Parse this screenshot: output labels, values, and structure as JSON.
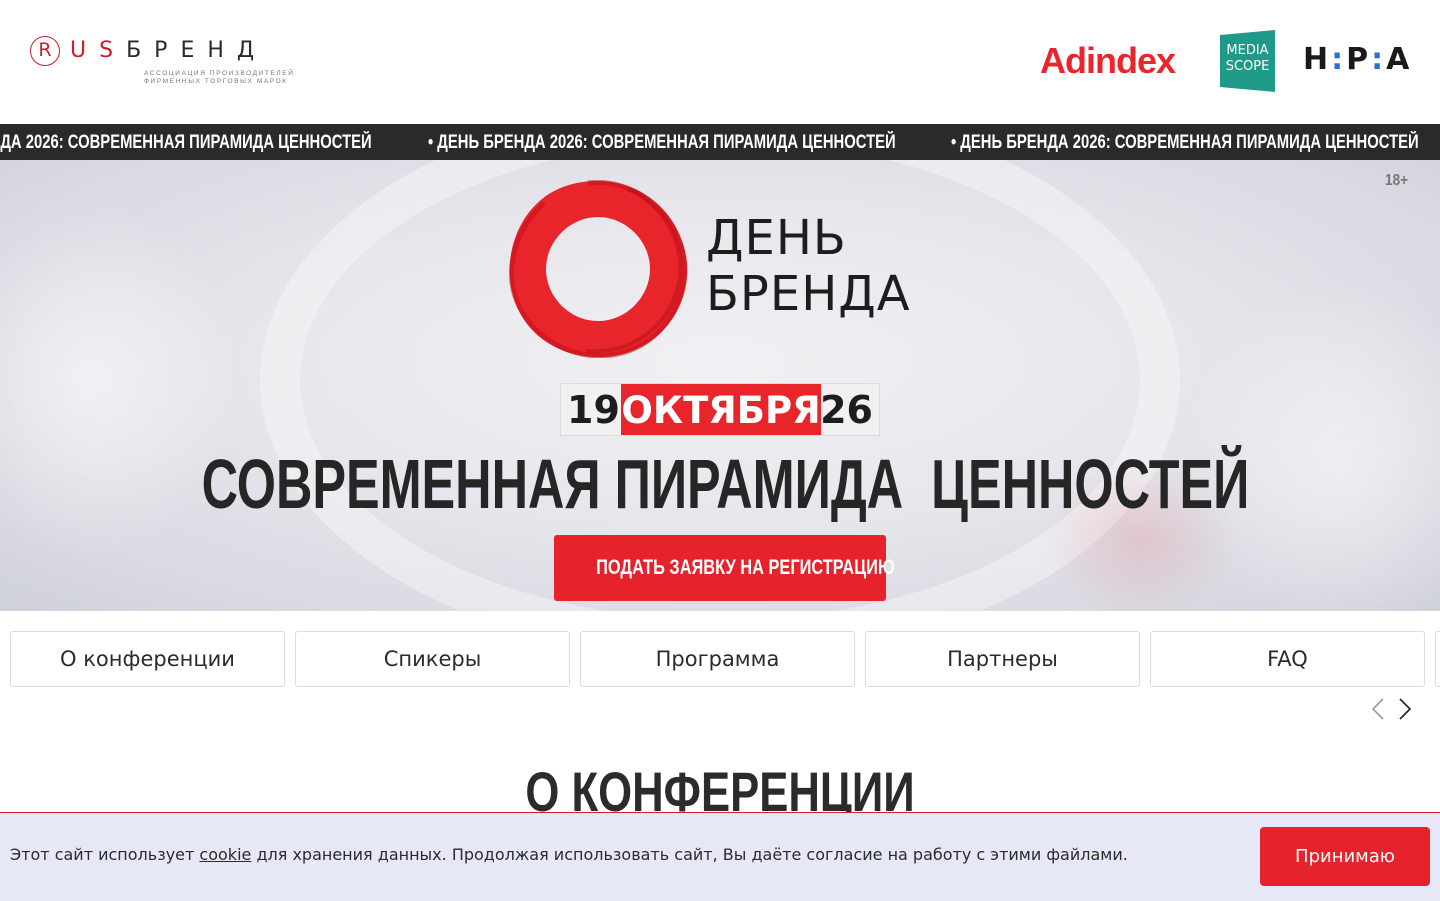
{
  "header": {
    "rus_logo": {
      "r": "R",
      "us": "US",
      "brand": "БРЕНД",
      "subtitle": "Ассоциация производителей фирменных торговых марок"
    },
    "partners": {
      "adindex": "Adindex",
      "mediascope_line1": "MEDIA",
      "mediascope_line2": "SCOPE",
      "npa_h": "H",
      "npa_p": "P",
      "npa_a": "A",
      "npa_sep": ":"
    }
  },
  "ticker": {
    "text": "• ДЕНЬ БРЕНДА 2026: СОВРЕМЕННАЯ ПИРАМИДА ЦЕННОСТЕЙ "
  },
  "hero": {
    "age_rating": "18+",
    "event_name_line1": "ДЕНЬ",
    "event_name_line2": "БРЕНДА",
    "date_day": "19",
    "date_month": "ОКТЯБРЯ",
    "date_year": "26",
    "title": "СОВРЕМЕННАЯ ПИРАМИДА  ЦЕННОСТЕЙ",
    "register_button": "ПОДАТЬ ЗАЯВКУ НА РЕГИСТРАЦИЮ"
  },
  "nav": {
    "tabs": [
      {
        "label": "О конференции"
      },
      {
        "label": "Спикеры"
      },
      {
        "label": "Программа"
      },
      {
        "label": "Партнеры"
      },
      {
        "label": "FAQ"
      }
    ]
  },
  "section": {
    "title": "О КОНФЕРЕНЦИИ"
  },
  "cookie_bar": {
    "text_before": "Этот сайт использует ",
    "link": "cookie",
    "text_after": " для хранения данных. Продолжая использовать сайт, Вы даёте согласие на работу с этими файлами.",
    "accept_button": "Принимаю"
  },
  "colors": {
    "brand_red": "#e6232a",
    "ticker_bg": "#2a2a2a",
    "mediascope": "#1f9a88",
    "cookie_bg": "#e6e8f7"
  }
}
